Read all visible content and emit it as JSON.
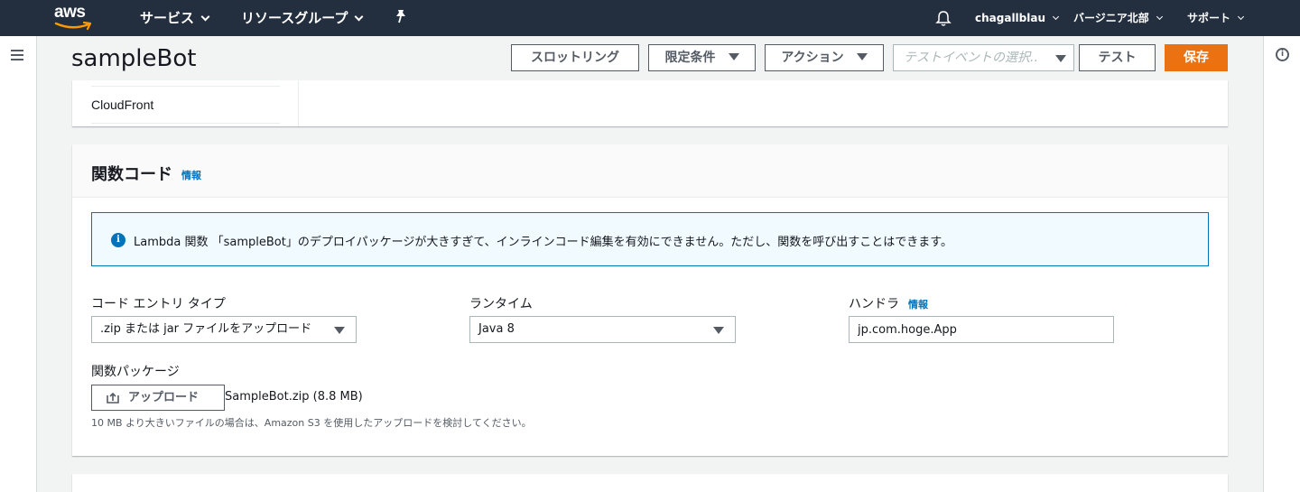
{
  "nav": {
    "logo_text": "aws",
    "services": "サービス",
    "resource_groups": "リソースグループ",
    "pin_icon": "pin-icon",
    "bell_icon": "bell-icon",
    "user": "chagallblau",
    "region": "バージニア北部",
    "support": "サポート"
  },
  "header": {
    "title": "sampleBot",
    "throttle": "スロットリング",
    "qualifiers": "限定条件",
    "actions": "アクション",
    "test_event_placeholder": "テストイベントの選択..",
    "test": "テスト",
    "save": "保存"
  },
  "top_fragment": {
    "item": "CloudFront"
  },
  "function_code": {
    "title": "関数コード",
    "info_link": "情報",
    "alert": "Lambda 関数 「sampleBot」のデプロイパッケージが大きすぎて、インラインコード編集を有効にできません。ただし、関数を呼び出すことはできます。",
    "code_entry_label": "コード エントリ タイプ",
    "code_entry_value": ".zip または jar ファイルをアップロード",
    "runtime_label": "ランタイム",
    "runtime_value": "Java 8",
    "handler_label": "ハンドラ",
    "handler_info": "情報",
    "handler_value": "jp.com.hoge.App",
    "package_label": "関数パッケージ",
    "upload_button": "アップロード",
    "file_name": "SampleBot.zip (8.8 MB)",
    "hint": "10 MB より大きいファイルの場合は、Amazon S3 を使用したアップロードを検討してください。"
  },
  "colors": {
    "nav_bg": "#232f3e",
    "primary": "#ec7211",
    "link": "#0073bb",
    "alert_bg": "#f1faff"
  }
}
